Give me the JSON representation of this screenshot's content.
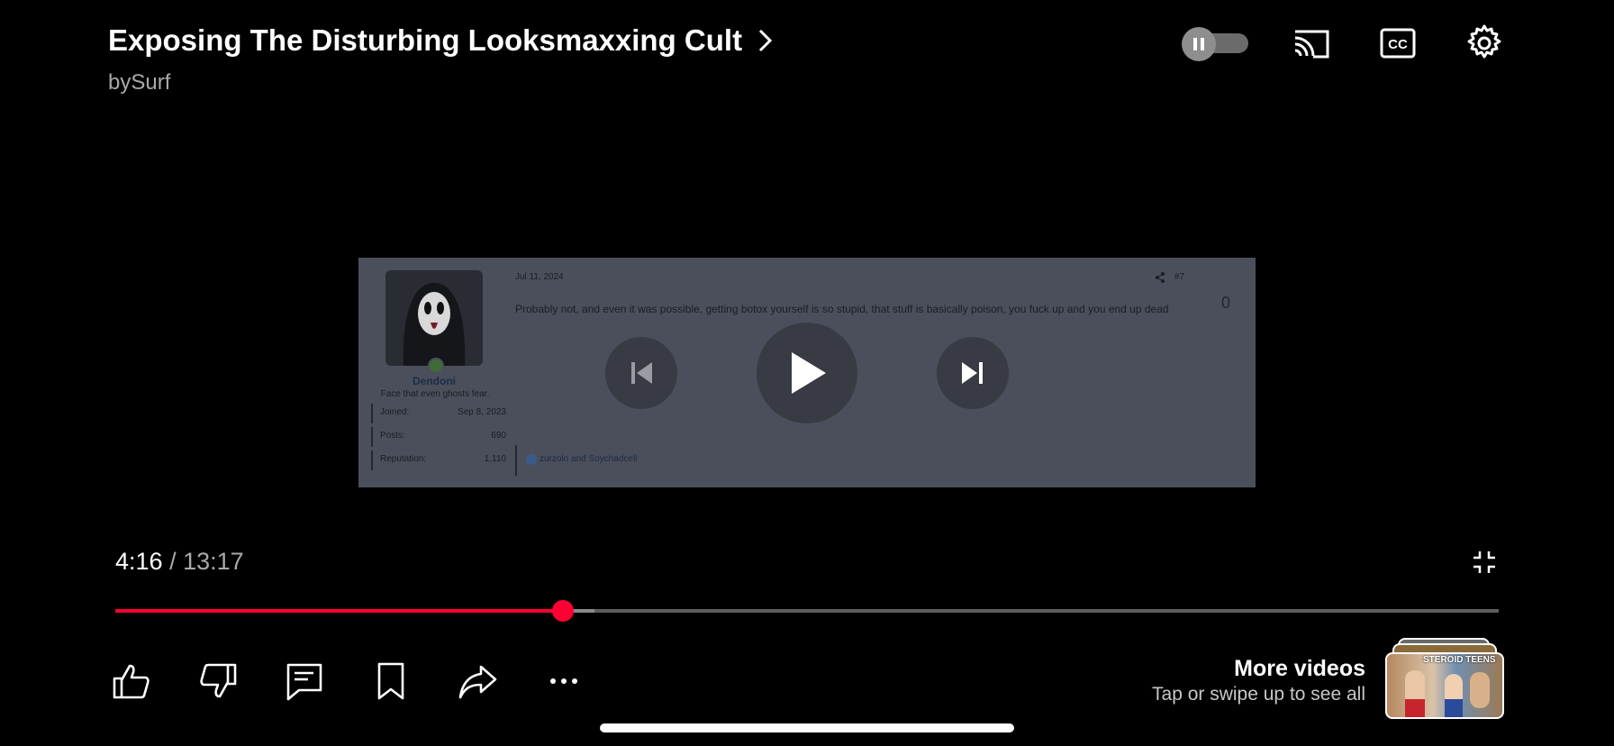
{
  "header": {
    "title": "Exposing The Disturbing Looksmaxxing Cult",
    "channel": "bySurf"
  },
  "video_frame": {
    "post_date": "Jul 11, 2024",
    "post_number": "#7",
    "vote_count": "0",
    "post_text": "Probably not, and even it was possible, getting botox yourself is so stupid, that stuff is basically poison, you fuck up and you end up dead",
    "username": "Dendoni",
    "user_title": "Face that even ghosts fear.",
    "stats": [
      {
        "label": "Joined:",
        "value": "Sep 8, 2023"
      },
      {
        "label": "Posts:",
        "value": "690"
      },
      {
        "label": "Reputation:",
        "value": "1,110"
      }
    ],
    "reactions": "zurzolo and Soychadcell"
  },
  "player": {
    "current_time": "4:16",
    "separator": " / ",
    "total_time": "13:17",
    "progress_fraction": 0.3237,
    "autoplay_on": false
  },
  "more_videos": {
    "title": "More videos",
    "subtitle": "Tap or swipe up to see all",
    "thumb_text": "STEROID TEENS"
  },
  "icons": [
    "chevron-right-icon",
    "pause-icon",
    "cast-icon",
    "cc-icon",
    "gear-icon",
    "previous-icon",
    "play-icon",
    "next-icon",
    "exit-fullscreen-icon",
    "thumbs-up-icon",
    "thumbs-down-icon",
    "comments-icon",
    "save-icon",
    "share-icon",
    "more-icon"
  ],
  "colors": {
    "progress": "#ff0033",
    "background": "#000000",
    "secondary_text": "#a9a9a9"
  }
}
